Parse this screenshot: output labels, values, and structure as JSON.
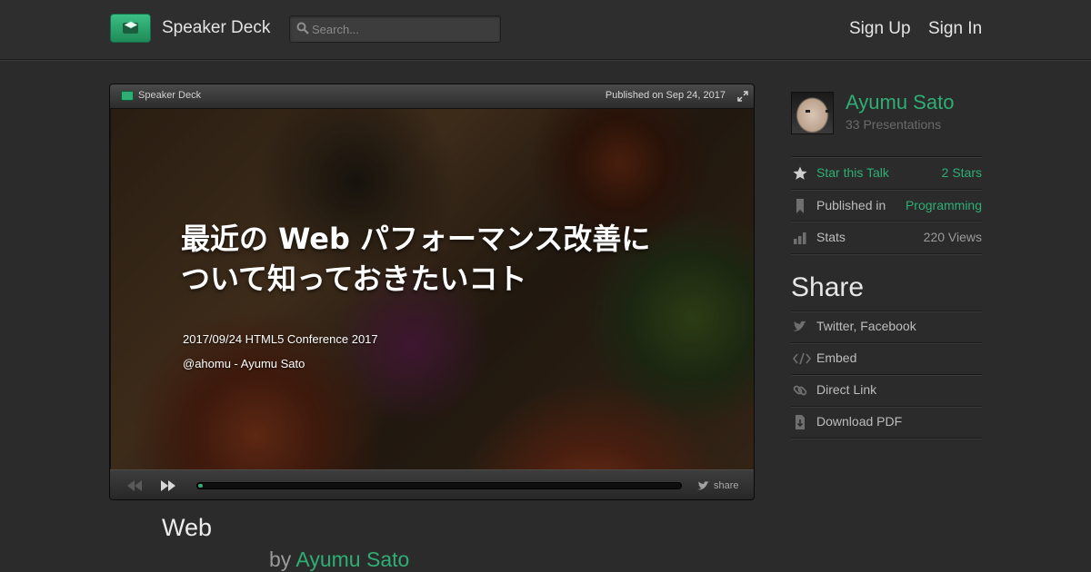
{
  "header": {
    "brand": "Speaker Deck",
    "search_placeholder": "Search...",
    "sign_up": "Sign Up",
    "sign_in": "Sign In"
  },
  "player": {
    "brand": "Speaker Deck",
    "published": "Published on Sep 24, 2017",
    "slide": {
      "title_line1": "最近の Web パフォーマンス改善に",
      "title_line2": "ついて知っておきたいコト",
      "meta_line1": "2017/09/24   HTML5 Conference 2017",
      "meta_line2": "@ahomu - Ayumu Sato"
    },
    "progress_fraction": 0.01,
    "share_label": "share"
  },
  "deck": {
    "title": "Web",
    "by": "by",
    "author": "Ayumu Sato"
  },
  "sidebar": {
    "author": {
      "name": "Ayumu Sato",
      "presentations": "33 Presentations"
    },
    "details": [
      {
        "label": "Star this Talk",
        "value": "2 Stars"
      },
      {
        "label": "Published in",
        "value": "Programming"
      },
      {
        "label": "Stats",
        "value": "220 Views"
      }
    ],
    "share_heading": "Share",
    "share_items": [
      {
        "label": "Twitter, Facebook"
      },
      {
        "label": "Embed"
      },
      {
        "label": "Direct Link"
      },
      {
        "label": "Download PDF"
      }
    ]
  },
  "colors": {
    "accent": "#2fae74",
    "background": "#2b2b2b"
  }
}
